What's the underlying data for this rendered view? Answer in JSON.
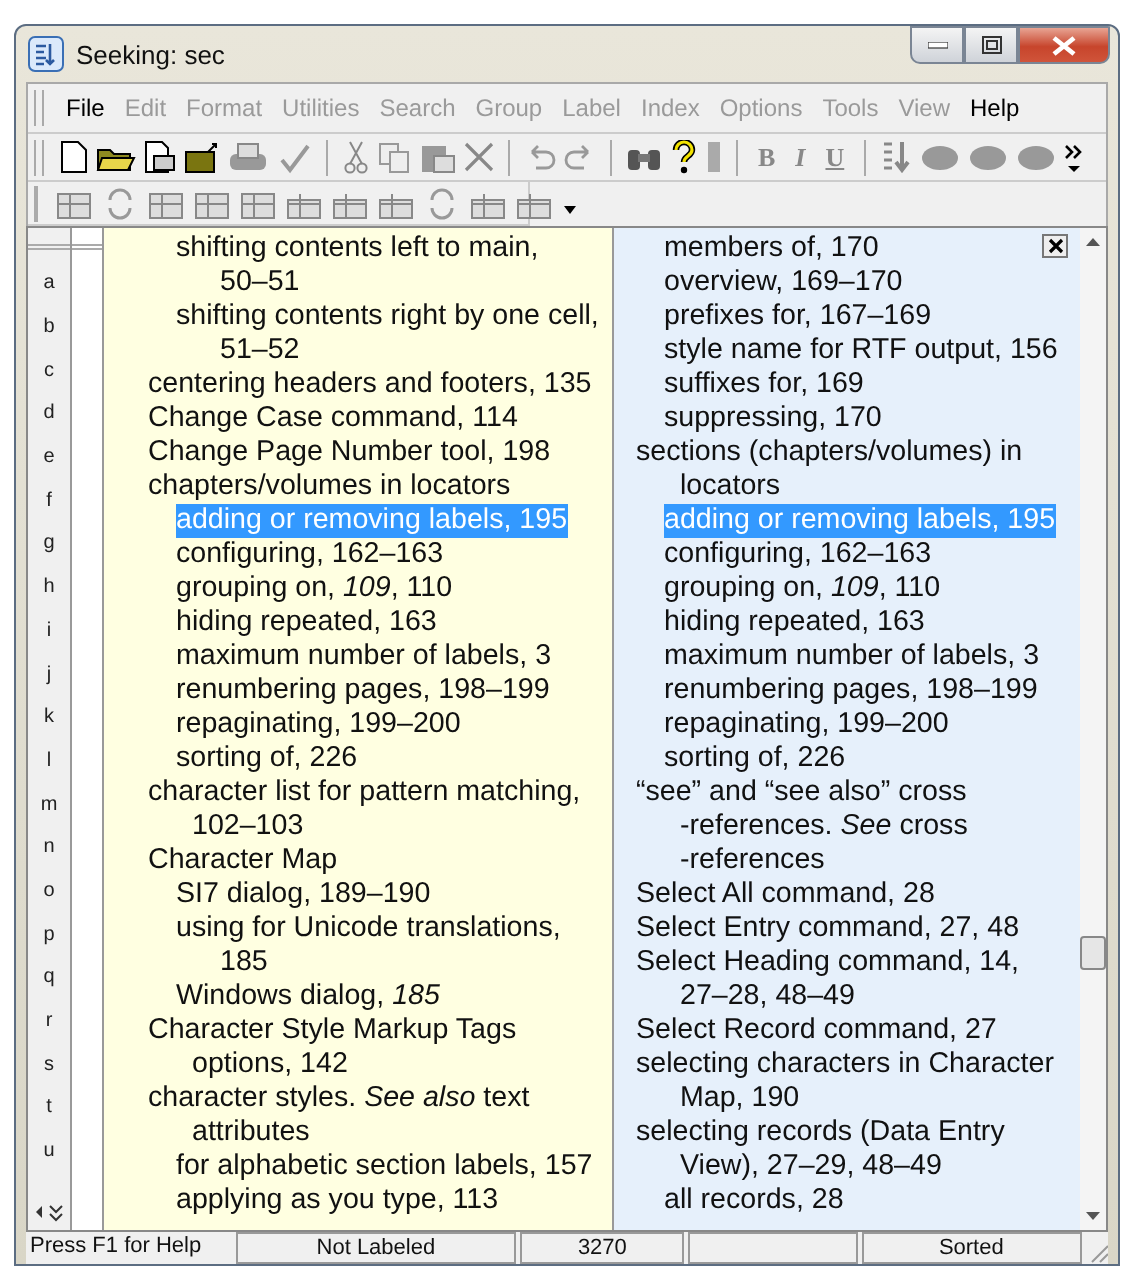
{
  "window": {
    "title": "Seeking: sec"
  },
  "menu": [
    {
      "label": "File",
      "disabled": false
    },
    {
      "label": "Edit",
      "disabled": true
    },
    {
      "label": "Format",
      "disabled": true
    },
    {
      "label": "Utilities",
      "disabled": true
    },
    {
      "label": "Search",
      "disabled": true
    },
    {
      "label": "Group",
      "disabled": true
    },
    {
      "label": "Label",
      "disabled": true
    },
    {
      "label": "Index",
      "disabled": true
    },
    {
      "label": "Options",
      "disabled": true
    },
    {
      "label": "Tools",
      "disabled": true
    },
    {
      "label": "View",
      "disabled": true
    },
    {
      "label": "Help",
      "disabled": false
    }
  ],
  "format_buttons": [
    "B",
    "I",
    "U"
  ],
  "letter_tabs": [
    "a",
    "b",
    "c",
    "d",
    "e",
    "f",
    "g",
    "h",
    "i",
    "j",
    "k",
    "l",
    "m",
    "n",
    "o",
    "p",
    "q",
    "r",
    "s",
    "t",
    "u"
  ],
  "left_pane": {
    "continued_subentries": [
      {
        "lines": [
          "shifting contents left to main,",
          "50–51"
        ],
        "selected": false
      },
      {
        "lines": [
          "shifting contents right by one cell,",
          "51–52"
        ],
        "selected": false
      }
    ],
    "entries": [
      {
        "lines": [
          "centering headers and footers, 135"
        ],
        "selected": false
      },
      {
        "lines": [
          "Change Case command, 114"
        ],
        "selected": false
      },
      {
        "lines": [
          "Change Page Number tool, 198"
        ],
        "selected": false
      },
      {
        "lines": [
          "chapters/volumes in locators"
        ],
        "selected": false,
        "children": [
          {
            "lines": [
              "adding or removing labels, 195"
            ],
            "selected": true
          },
          {
            "lines": [
              "configuring, 162–163"
            ],
            "selected": false
          },
          {
            "lines": [
              "grouping on, *109*, 110"
            ],
            "selected": false
          },
          {
            "lines": [
              "hiding repeated, 163"
            ],
            "selected": false
          },
          {
            "lines": [
              "maximum number of labels, 3"
            ],
            "selected": false
          },
          {
            "lines": [
              "renumbering pages, 198–199"
            ],
            "selected": false
          },
          {
            "lines": [
              "repaginating, 199–200"
            ],
            "selected": false
          },
          {
            "lines": [
              "sorting of, 226"
            ],
            "selected": false
          }
        ]
      },
      {
        "lines": [
          "character list for pattern matching,",
          "102–103"
        ],
        "selected": false
      },
      {
        "lines": [
          "Character Map"
        ],
        "selected": false,
        "children": [
          {
            "lines": [
              "SI7 dialog, 189–190"
            ],
            "selected": false
          },
          {
            "lines": [
              "using for Unicode translations,",
              "185"
            ],
            "selected": false
          },
          {
            "lines": [
              "Windows dialog, *185*"
            ],
            "selected": false
          }
        ]
      },
      {
        "lines": [
          "Character Style Markup Tags",
          "options, 142"
        ],
        "selected": false
      },
      {
        "lines": [
          "character styles. *See also* text",
          "attributes"
        ],
        "selected": false,
        "children": [
          {
            "lines": [
              "for alphabetic section labels, 157"
            ],
            "selected": false
          },
          {
            "lines": [
              "applying as you type, 113"
            ],
            "selected": false
          }
        ]
      }
    ]
  },
  "right_pane": {
    "continued_subentries": [
      {
        "lines": [
          "members of, 170"
        ],
        "selected": false
      },
      {
        "lines": [
          "overview, 169–170"
        ],
        "selected": false
      },
      {
        "lines": [
          "prefixes for, 167–169"
        ],
        "selected": false
      },
      {
        "lines": [
          "style name for RTF output, 156"
        ],
        "selected": false
      },
      {
        "lines": [
          "suffixes for, 169"
        ],
        "selected": false
      },
      {
        "lines": [
          "suppressing, 170"
        ],
        "selected": false
      }
    ],
    "entries": [
      {
        "lines": [
          "sections (chapters/volumes) in",
          "locators"
        ],
        "selected": false,
        "children": [
          {
            "lines": [
              "adding or removing labels, 195"
            ],
            "selected": true
          },
          {
            "lines": [
              "configuring, 162–163"
            ],
            "selected": false
          },
          {
            "lines": [
              "grouping on, *109*, 110"
            ],
            "selected": false
          },
          {
            "lines": [
              "hiding repeated, 163"
            ],
            "selected": false
          },
          {
            "lines": [
              "maximum number of labels, 3"
            ],
            "selected": false
          },
          {
            "lines": [
              "renumbering pages, 198–199"
            ],
            "selected": false
          },
          {
            "lines": [
              "repaginating, 199–200"
            ],
            "selected": false
          },
          {
            "lines": [
              "sorting of, 226"
            ],
            "selected": false
          }
        ]
      },
      {
        "lines": [
          "“see” and “see also” cross",
          "-references. *See* cross",
          "-references"
        ],
        "selected": false
      },
      {
        "lines": [
          "Select All command, 28"
        ],
        "selected": false
      },
      {
        "lines": [
          "Select Entry command, 27, 48"
        ],
        "selected": false
      },
      {
        "lines": [
          "Select Heading command, 14,",
          "27–28, 48–49"
        ],
        "selected": false
      },
      {
        "lines": [
          "Select Record command, 27"
        ],
        "selected": false
      },
      {
        "lines": [
          "selecting characters in Character",
          "Map, 190"
        ],
        "selected": false
      },
      {
        "lines": [
          "selecting records (Data Entry",
          "View), 27–29, 48–49"
        ],
        "selected": false,
        "children": [
          {
            "lines": [
              "all records, 28"
            ],
            "selected": false
          }
        ]
      }
    ]
  },
  "status_bar": [
    "Press F1 for Help",
    "Not Labeled",
    "3270",
    "Sorted"
  ]
}
